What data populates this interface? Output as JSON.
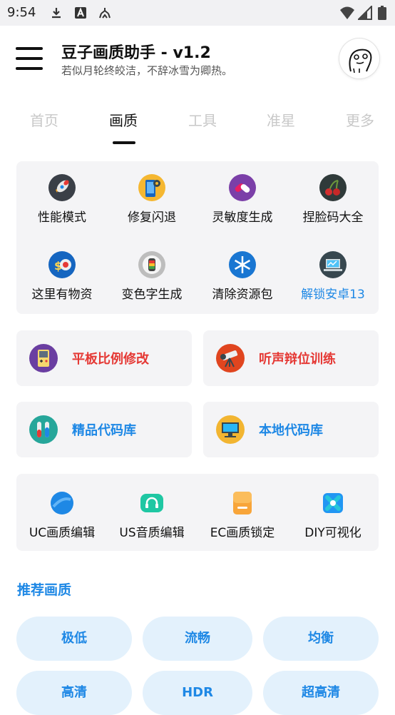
{
  "status_bar": {
    "time": "9:54"
  },
  "header": {
    "title": "豆子画质助手 - v1.2",
    "subtitle": "若似月轮终皎洁，不辞冰雪为卿热。"
  },
  "tabs": [
    "首页",
    "画质",
    "工具",
    "准星",
    "更多"
  ],
  "active_tab": "画质",
  "grid1": [
    {
      "label": "性能模式",
      "icon": "rocket-icon"
    },
    {
      "label": "修复闪退",
      "icon": "phone-settings-icon"
    },
    {
      "label": "灵敏度生成",
      "icon": "pills-icon"
    },
    {
      "label": "捏脸码大全",
      "icon": "cherries-icon"
    },
    {
      "label": "这里有物资",
      "icon": "money-icon"
    },
    {
      "label": "变色字生成",
      "icon": "color-palette-icon"
    },
    {
      "label": "清除资源包",
      "icon": "snowflake-icon"
    },
    {
      "label": "解锁安卓13",
      "icon": "laptop-icon"
    }
  ],
  "wide_cards": [
    {
      "label": "平板比例修改",
      "icon": "gameboy-icon"
    },
    {
      "label": "听声辩位训练",
      "icon": "telescope-icon"
    },
    {
      "label": "精品代码库",
      "icon": "test-tubes-icon"
    },
    {
      "label": "本地代码库",
      "icon": "desktop-computer-icon"
    }
  ],
  "grid2": [
    {
      "label": "UC画质编辑",
      "icon": "blue-circle-icon"
    },
    {
      "label": "US音质编辑",
      "icon": "headphones-icon"
    },
    {
      "label": "EC画质锁定",
      "icon": "orange-card-icon"
    },
    {
      "label": "DIY可视化",
      "icon": "crossed-icon"
    }
  ],
  "recommend": {
    "title": "推荐画质",
    "options": [
      "极低",
      "流畅",
      "均衡",
      "高清",
      "HDR",
      "超高清"
    ]
  },
  "colors": {
    "accent_blue": "#1e88e5",
    "accent_red": "#e53935",
    "card_bg": "#f4f4f6",
    "pill_bg": "#e3f1fc"
  }
}
